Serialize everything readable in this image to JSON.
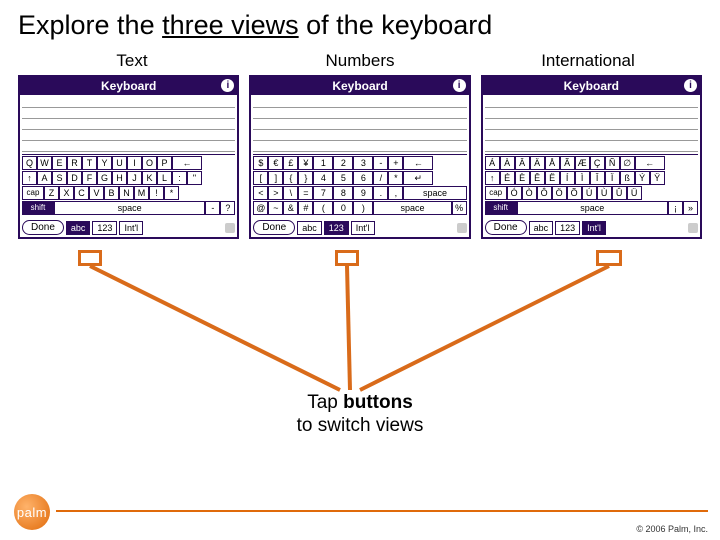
{
  "title_a": "Explore the ",
  "title_b": "three views",
  "title_c": " of the keyboard",
  "labels": {
    "text": "Text",
    "numbers": "Numbers",
    "intl": "International"
  },
  "hdr": "Keyboard",
  "info": "i",
  "text_kbd": {
    "r1": [
      "Q",
      "W",
      "E",
      "R",
      "T",
      "Y",
      "U",
      "I",
      "O",
      "P",
      "←"
    ],
    "r2": [
      "↑",
      "A",
      "S",
      "D",
      "F",
      "G",
      "H",
      "J",
      "K",
      "L",
      ":",
      "\""
    ],
    "r3": [
      "Z",
      "X",
      "C",
      "V",
      "B",
      "N",
      "M",
      "!",
      "*"
    ],
    "cap": "cap",
    "shift": "shift",
    "space": "space",
    "dash": "-",
    "q": "?"
  },
  "num_kbd": {
    "left_r1": [
      "$",
      "€",
      "£",
      "¥"
    ],
    "left_r2": [
      "[",
      "]",
      "{",
      "}"
    ],
    "left_r3": [
      "<",
      ">",
      "\\",
      "="
    ],
    "left_r4": [
      "@",
      "~",
      "&",
      "#"
    ],
    "pad": [
      "1",
      "2",
      "3",
      "4",
      "5",
      "6",
      "7",
      "8",
      "9",
      "(",
      "0",
      ")"
    ],
    "right_r1": [
      "-",
      "+",
      "←"
    ],
    "right_r2": [
      "/",
      "*",
      "↵"
    ],
    "right_r3": [
      ".",
      ","
    ],
    "right_r4": [
      "%"
    ],
    "space": "space"
  },
  "intl_kbd": {
    "r1": [
      "Á",
      "À",
      "Â",
      "Ä",
      "Å",
      "Ã",
      "Æ",
      "Ç",
      "Ñ",
      "∅",
      "←"
    ],
    "r2": [
      "↑",
      "É",
      "È",
      "Ê",
      "Ë",
      "Í",
      "Ì",
      "Î",
      "Ï",
      "ß",
      "Ý",
      "Ÿ"
    ],
    "r3": [
      "Ó",
      "Ò",
      "Ô",
      "Ö",
      "Õ",
      "Ú",
      "Ù",
      "Û",
      "Ü"
    ],
    "cap": "cap",
    "shift": "shift",
    "space": "space",
    "ex": "¡",
    "raq": "»"
  },
  "bot": {
    "done": "Done",
    "abc": "abc",
    "n123": "123",
    "intl": "Int'l"
  },
  "caption_a": "Tap ",
  "caption_b": "buttons",
  "caption_c": "to switch views",
  "copyright": "© 2006 Palm, Inc.",
  "logo": "palm"
}
